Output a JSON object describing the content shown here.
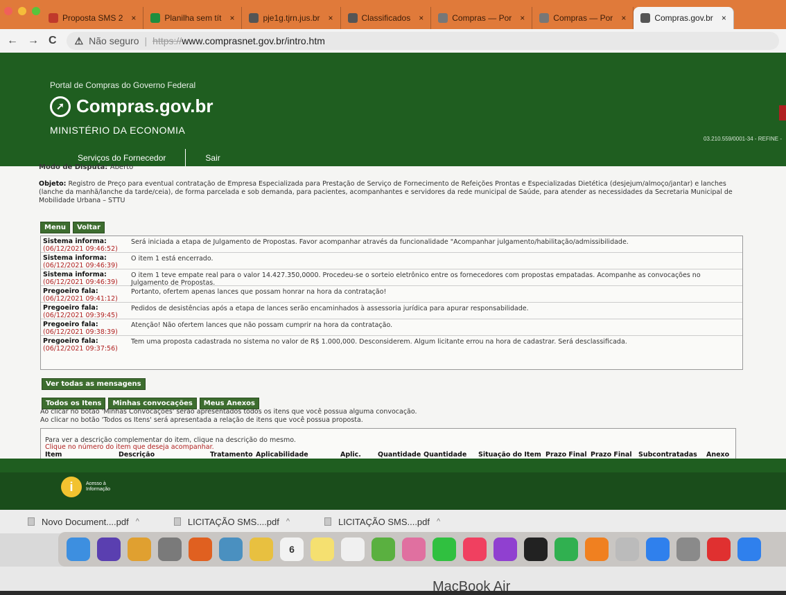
{
  "browser": {
    "tabs": [
      {
        "label": "Proposta SMS 2",
        "icon": "gmail-icon",
        "color": "#c0392b",
        "active": false
      },
      {
        "label": "Planilha sem tít",
        "icon": "sheets-icon",
        "color": "#1e8e3e",
        "active": false
      },
      {
        "label": "pje1g.tjrn.jus.br",
        "icon": "globe-icon",
        "color": "#555555",
        "active": false
      },
      {
        "label": "Classificados",
        "icon": "globe-icon",
        "color": "#555555",
        "active": false
      },
      {
        "label": "Compras — Por",
        "icon": "page-icon",
        "color": "#777777",
        "active": false
      },
      {
        "label": "Compras — Por",
        "icon": "page-icon",
        "color": "#777777",
        "active": false
      },
      {
        "label": "Compras.gov.br",
        "icon": "globe-icon",
        "color": "#555555",
        "active": true
      }
    ],
    "tab_close": "×",
    "security_label": "Não seguro",
    "url_scheme": "https://",
    "url_rest": "www.comprasnet.gov.br/intro.htm"
  },
  "site": {
    "portal": "Portal de Compras do Governo Federal",
    "logo": "Compras.gov.br",
    "ministry": "MINISTÉRIO DA ECONOMIA",
    "cnpj": "03.210.559/0001-34 - REFINE -",
    "nav": [
      "Serviços do Fornecedor",
      "Sair"
    ]
  },
  "content": {
    "modo_label": "Modo de Disputa:",
    "modo_value": "Aberto",
    "objeto_label": "Objeto:",
    "objeto_text": "Registro de Preço para eventual contratação de Empresa Especializada para Prestação de Serviço de Fornecimento de Refeições Prontas e Especializadas Dietética (desjejum/almoço/jantar) e lanches (lanche da manhã/lanche da tarde/ceia), de forma parcelada e sob demanda, para pacientes, acompanhantes e servidores da rede municipal de Saúde, para atender as necessidades da Secretaria Municipal de Mobilidade Urbana – STTU",
    "buttons": [
      "Menu",
      "Voltar"
    ],
    "messages": [
      {
        "who": "Sistema informa:",
        "when": "(06/12/2021 09:46:52)",
        "text": "Será iniciada a etapa de Julgamento de Propostas. Favor acompanhar através da funcionalidade \"Acompanhar julgamento/habilitação/admissibilidade."
      },
      {
        "who": "Sistema informa:",
        "when": "(06/12/2021 09:46:39)",
        "text": "O item 1 está encerrado."
      },
      {
        "who": "Sistema informa:",
        "when": "(06/12/2021 09:46:39)",
        "text": "O item 1 teve empate real para o valor 14.427.350,0000. Procedeu-se o sorteio eletrônico entre os fornecedores com propostas empatadas. Acompanhe as convocações no Julgamento de Propostas."
      },
      {
        "who": "Pregoeiro fala:",
        "when": "(06/12/2021 09:41:12)",
        "text": "Portanto, ofertem apenas lances que possam honrar na hora da contratação!"
      },
      {
        "who": "Pregoeiro fala:",
        "when": "(06/12/2021 09:39:45)",
        "text": "Pedidos de desistências após a etapa de lances serão encaminhados à assessoria jurídica para apurar responsabilidade."
      },
      {
        "who": "Pregoeiro fala:",
        "when": "(06/12/2021 09:38:39)",
        "text": "Atenção! Não ofertem lances que não possam cumprir na hora da contratação."
      },
      {
        "who": "Pregoeiro fala:",
        "when": "(06/12/2021 09:37:56)",
        "text": "Tem uma proposta cadastrada no sistema no valor de R$ 1.000,000. Desconsiderem. Algum licitante errou na hora de cadastrar. Será desclassificada."
      }
    ],
    "ver_todas": "Ver todas as mensagens",
    "item_tabs": [
      "Todos os Itens",
      "Minhas convocações",
      "Meus Anexos"
    ],
    "info1": "Ao clicar no botão 'Minhas Convocações' serão apresentados todos os itens que você possua alguma convocação.",
    "info2": "Ao clicar no botão 'Todos os Itens' será apresentada a relação de itens que você possua proposta.",
    "item_hint1": "Para ver a descrição complementar do item, clique na descrição do mesmo.",
    "item_hint2": "Clique no número do item que deseja acompanhar.",
    "columns": [
      "Item",
      "Descrição",
      "Tratamento",
      "Aplicabilidade",
      "Aplic.",
      "Quantidade",
      "Quantidade",
      "Situação do Item",
      "Prazo Final",
      "Prazo Final",
      "Subcontratadas",
      "Anexo"
    ]
  },
  "footer": {
    "acesso_line1": "Acesso à",
    "acesso_line2": "Informação"
  },
  "downloads": [
    {
      "name": "Novo Document....pdf"
    },
    {
      "name": "LICITAÇÃO SMS....pdf"
    },
    {
      "name": "LICITAÇÃO SMS....pdf"
    }
  ],
  "dock": {
    "calendar_day": "6",
    "icons": [
      {
        "name": "finder-icon",
        "color": "#3d8fe0"
      },
      {
        "name": "siri-icon",
        "color": "#5a3fb0"
      },
      {
        "name": "chrome-icon",
        "color": "#e0a030"
      },
      {
        "name": "launchpad-icon",
        "color": "#7a7a7a"
      },
      {
        "name": "firefox-icon",
        "color": "#e06020"
      },
      {
        "name": "preview-icon",
        "color": "#4a90c0"
      },
      {
        "name": "notes-icon",
        "color": "#e8c040"
      },
      {
        "name": "calendar-icon",
        "color": "#f2f2f2"
      },
      {
        "name": "stickies-icon",
        "color": "#f5e070"
      },
      {
        "name": "reminders-icon",
        "color": "#f0f0f0"
      },
      {
        "name": "maps-icon",
        "color": "#5ab040"
      },
      {
        "name": "photos-icon",
        "color": "#e070a0"
      },
      {
        "name": "messages-icon",
        "color": "#30c040"
      },
      {
        "name": "music-icon",
        "color": "#f04060"
      },
      {
        "name": "podcasts-icon",
        "color": "#9040d0"
      },
      {
        "name": "tv-icon",
        "color": "#222222"
      },
      {
        "name": "facetime-icon",
        "color": "#30b050"
      },
      {
        "name": "books-icon",
        "color": "#f08020"
      },
      {
        "name": "help-icon",
        "color": "#bbbbbb"
      },
      {
        "name": "appstore-icon",
        "color": "#2f80ed"
      },
      {
        "name": "settings-icon",
        "color": "#8a8a8a"
      },
      {
        "name": "anydesk-icon",
        "color": "#e03030"
      },
      {
        "name": "safari-icon",
        "color": "#2f80ed"
      }
    ]
  },
  "device_label": "MacBook Air"
}
